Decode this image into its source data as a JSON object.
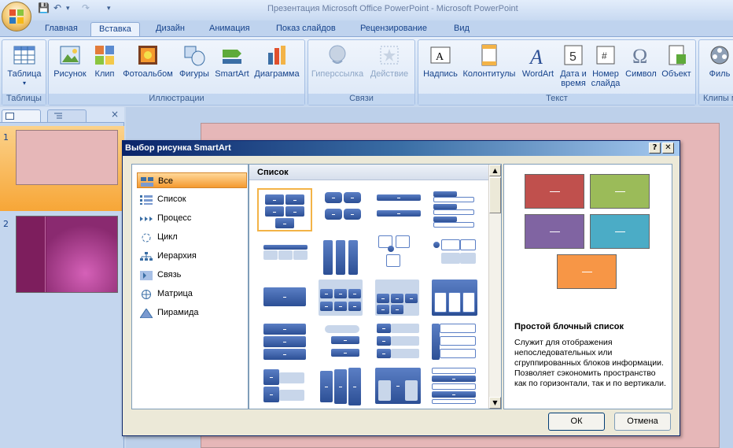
{
  "window": {
    "title": "Презентация Microsoft Office PowerPoint - Microsoft PowerPoint"
  },
  "tabs": [
    "Главная",
    "Вставка",
    "Дизайн",
    "Анимация",
    "Показ слайдов",
    "Рецензирование",
    "Вид"
  ],
  "active_tab": "Вставка",
  "ribbon": {
    "groups": [
      {
        "label": "Таблицы"
      },
      {
        "label": "Иллюстрации"
      },
      {
        "label": "Связи"
      },
      {
        "label": "Текст"
      },
      {
        "label": "Клипы м"
      }
    ],
    "buttons": {
      "table": "Таблица",
      "picture": "Рисунок",
      "clip": "Клип",
      "photoalbum": "Фотоальбом",
      "shapes": "Фигуры",
      "smartart": "SmartArt",
      "chart": "Диаграмма",
      "hyperlink": "Гиперссылка",
      "action": "Действие",
      "textbox": "Надпись",
      "header_footer": "Колонтитулы",
      "wordart": "WordArt",
      "datetime_1": "Дата и",
      "datetime_2": "время",
      "slidenum_1": "Номер",
      "slidenum_2": "слайда",
      "symbol": "Символ",
      "object": "Объект",
      "movie": "Филь"
    }
  },
  "slides": [
    {
      "number": "1"
    },
    {
      "number": "2"
    }
  ],
  "dialog": {
    "title": "Выбор рисунка SmartArt",
    "help": "?",
    "close": "✕",
    "categories": [
      "Все",
      "Список",
      "Процесс",
      "Цикл",
      "Иерархия",
      "Связь",
      "Матрица",
      "Пирамида"
    ],
    "selected_category": "Все",
    "gallery_header": "Список",
    "preview": {
      "title": "Простой блочный список",
      "description": "Служит для отображения непоследовательных или сгруппированных блоков информации. Позволяет сэкономить пространство как по горизонтали, так и по вертикали.",
      "colors": [
        "#c0504d",
        "#9bbb59",
        "#8064a2",
        "#4bacc6",
        "#f79646"
      ]
    },
    "ok": "ОК",
    "cancel": "Отмена"
  }
}
